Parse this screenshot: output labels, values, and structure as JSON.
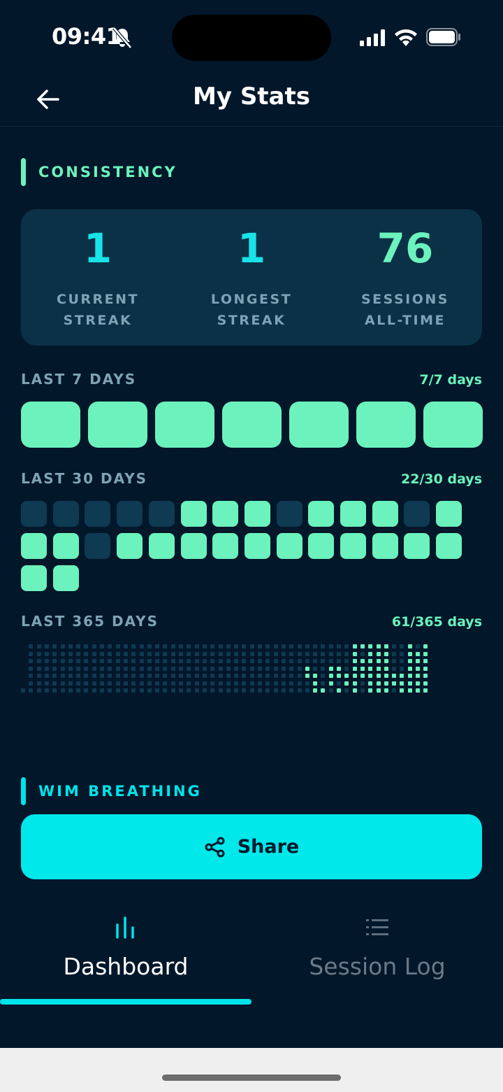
{
  "status_bar": {
    "time": "09:41",
    "icons": [
      "bell-slash-icon",
      "signal-icon",
      "wifi-icon",
      "battery-icon"
    ]
  },
  "header": {
    "title": "My Stats",
    "back_icon": "arrow-left-icon"
  },
  "colors": {
    "background": "#02172a",
    "card": "#0b3146",
    "accent_green": "#6cf2bc",
    "accent_cyan": "#00e3ea",
    "cell_inactive": "#0e3a52",
    "muted_text": "#7fa3b5"
  },
  "consistency": {
    "heading": "CONSISTENCY",
    "stats": [
      {
        "value": "1",
        "label_line1": "CURRENT",
        "label_line2": "STREAK",
        "color": "#18e3e8"
      },
      {
        "value": "1",
        "label_line1": "LONGEST",
        "label_line2": "STREAK",
        "color": "#18e3e8"
      },
      {
        "value": "76",
        "label_line1": "SESSIONS",
        "label_line2": "ALL-TIME",
        "color": "#6cf2bc"
      }
    ]
  },
  "last_7": {
    "label": "LAST 7 DAYS",
    "count_text": "7/7 days",
    "days": [
      1,
      1,
      1,
      1,
      1,
      1,
      1
    ]
  },
  "last_30": {
    "label": "LAST 30 DAYS",
    "count_text": "22/30 days",
    "days": [
      0,
      0,
      0,
      0,
      0,
      1,
      1,
      1,
      0,
      1,
      1,
      1,
      0,
      1,
      1,
      1,
      0,
      1,
      1,
      1,
      1,
      1,
      1,
      1,
      1,
      1,
      1,
      1,
      1,
      1
    ]
  },
  "last_365": {
    "label": "LAST 365 DAYS",
    "count_text": "61/365 days"
  },
  "wim_breathing": {
    "heading": "WIM BREATHING"
  },
  "share": {
    "label": "Share",
    "icon": "share-icon"
  },
  "tabs": [
    {
      "label": "Dashboard",
      "icon": "bar-chart-icon",
      "active": true
    },
    {
      "label": "Session Log",
      "icon": "list-icon",
      "active": false
    }
  ]
}
